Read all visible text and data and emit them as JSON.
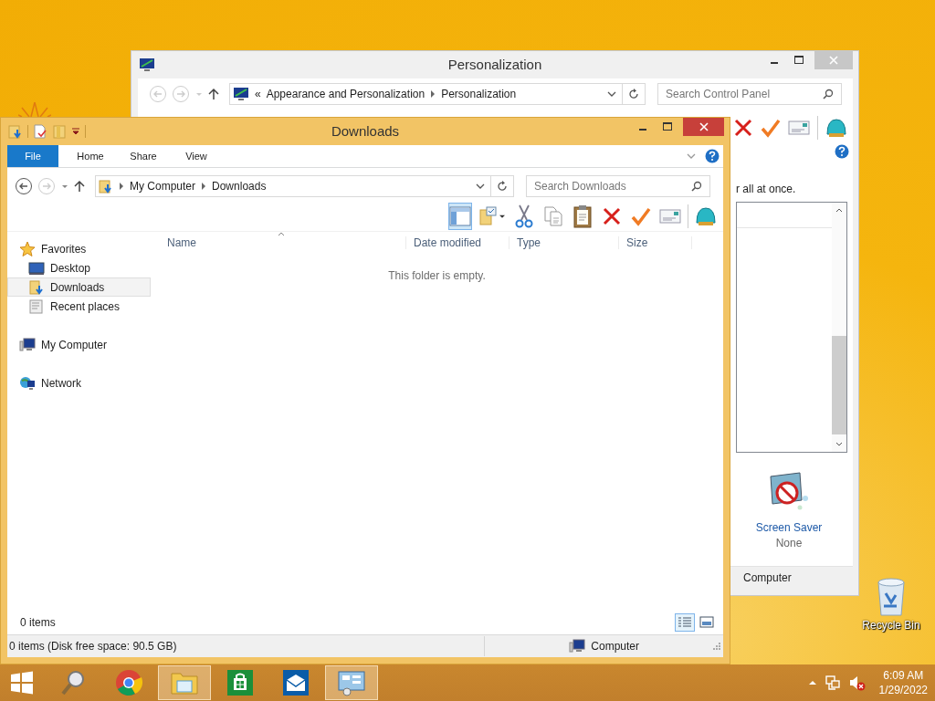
{
  "desktop": {
    "icons": [
      {
        "label": "Recycle Bin"
      }
    ]
  },
  "personalization_window": {
    "title": "Personalization",
    "address": {
      "prefix": "«",
      "crumbs": [
        "Appearance and Personalization",
        "Personalization"
      ]
    },
    "search": {
      "placeholder": "Search Control Panel"
    },
    "text_fragment": "r all at once.",
    "screen_saver": {
      "label": "Screen Saver",
      "value": "None"
    },
    "status": "Computer"
  },
  "downloads_window": {
    "title": "Downloads",
    "ribbon_tabs": [
      {
        "label": "File",
        "kind": "file"
      },
      {
        "label": "Home",
        "kind": "tab"
      },
      {
        "label": "Share",
        "kind": "tab"
      },
      {
        "label": "View",
        "kind": "tab"
      }
    ],
    "address": {
      "crumbs": [
        "My Computer",
        "Downloads"
      ]
    },
    "search": {
      "placeholder": "Search Downloads"
    },
    "toolbar": [
      {
        "kind": "layout",
        "selected": true
      },
      {
        "kind": "folder-options",
        "selected": false
      },
      {
        "kind": "cut",
        "selected": false
      },
      {
        "kind": "copy",
        "selected": false
      },
      {
        "kind": "paste",
        "selected": false
      },
      {
        "kind": "delete",
        "selected": false
      },
      {
        "kind": "check",
        "selected": false
      },
      {
        "kind": "card",
        "selected": false
      },
      {
        "kind": "shell",
        "selected": false
      }
    ],
    "nav": [
      {
        "label": "Favorites",
        "kind": "favorites",
        "selected": false,
        "children": [
          {
            "label": "Desktop",
            "kind": "desktop",
            "selected": false
          },
          {
            "label": "Downloads",
            "kind": "downloads",
            "selected": true
          },
          {
            "label": "Recent places",
            "kind": "recent",
            "selected": false
          }
        ]
      },
      {
        "label": "My Computer",
        "kind": "computer",
        "selected": false
      },
      {
        "label": "Network",
        "kind": "network",
        "selected": false
      }
    ],
    "columns": [
      "Name",
      "Date modified",
      "Type",
      "Size"
    ],
    "empty_message": "This folder is empty.",
    "item_count": "0 items",
    "view_buttons": [
      {
        "kind": "details",
        "selected": true
      },
      {
        "kind": "thumbnails",
        "selected": false
      }
    ],
    "status": {
      "text": "0 items (Disk free space: 90.5 GB)",
      "location": "Computer"
    }
  },
  "taskbar": {
    "apps": [
      {
        "kind": "start",
        "active": false
      },
      {
        "kind": "search",
        "active": false
      },
      {
        "kind": "browser",
        "active": false
      },
      {
        "kind": "explorer",
        "active": true
      },
      {
        "kind": "store",
        "active": false
      },
      {
        "kind": "mail",
        "active": false
      },
      {
        "kind": "control-panel",
        "active": true
      }
    ],
    "tray": {
      "muted": true,
      "time": "6:09 AM",
      "date": "1/29/2022"
    }
  }
}
